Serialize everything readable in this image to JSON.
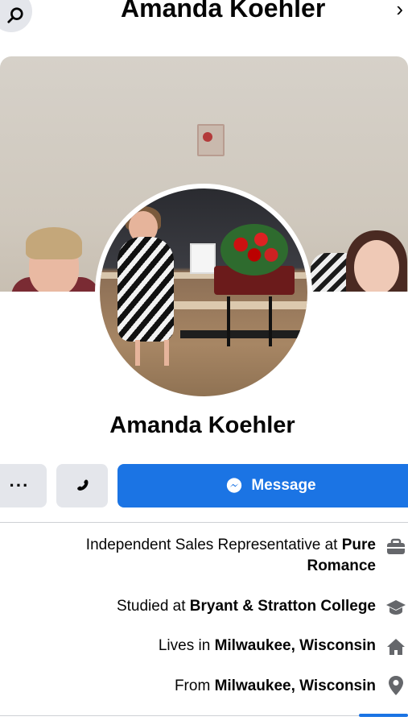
{
  "header": {
    "title": "Amanda Koehler",
    "back_glyph": "›"
  },
  "profile": {
    "name": "Amanda Koehler"
  },
  "actions": {
    "message_label": "Message",
    "more_label": "···"
  },
  "details": [
    {
      "prefix": "Independent Sales Representative at ",
      "bold": "Pure Romance",
      "icon": "briefcase-icon"
    },
    {
      "prefix": "Studied at ",
      "bold": "Bryant & Stratton College",
      "icon": "graduation-cap-icon"
    },
    {
      "prefix": "Lives in ",
      "bold": "Milwaukee, Wisconsin",
      "icon": "home-icon"
    },
    {
      "prefix": "From ",
      "bold": "Milwaukee, Wisconsin",
      "icon": "location-pin-icon"
    }
  ],
  "colors": {
    "accent": "#1b74e4",
    "button_gray": "#e4e6eb",
    "text": "#050505"
  }
}
